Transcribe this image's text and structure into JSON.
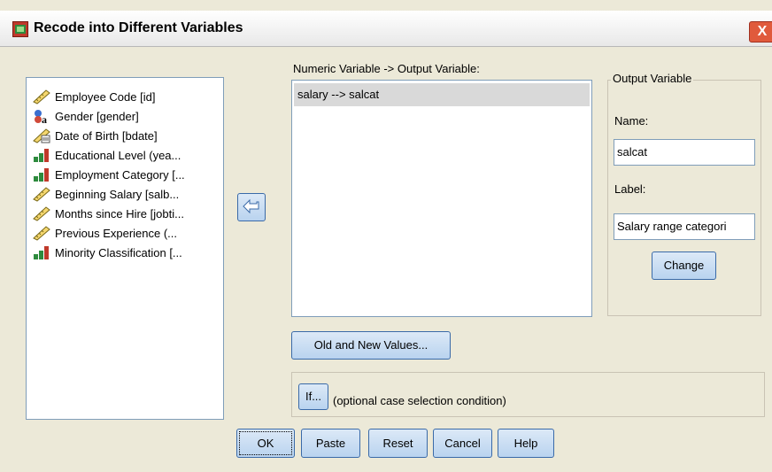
{
  "window": {
    "title": "Recode into Different Variables",
    "close_label": "X"
  },
  "source_list": {
    "items": [
      {
        "label": "Employee Code [id]",
        "icon": "scale-ruler-icon"
      },
      {
        "label": "Gender [gender]",
        "icon": "nominal-string-icon"
      },
      {
        "label": "Date of Birth [bdate]",
        "icon": "date-ruler-icon"
      },
      {
        "label": "Educational Level (yea...",
        "icon": "ordinal-bar-icon"
      },
      {
        "label": "Employment Category [...",
        "icon": "ordinal-bar-icon"
      },
      {
        "label": "Beginning Salary [salb...",
        "icon": "scale-ruler-icon"
      },
      {
        "label": "Months since Hire [jobti...",
        "icon": "scale-ruler-icon"
      },
      {
        "label": "Previous Experience (...",
        "icon": "scale-ruler-icon"
      },
      {
        "label": "Minority Classification [...",
        "icon": "ordinal-bar-icon"
      }
    ]
  },
  "mapping": {
    "header": "Numeric Variable -> Output Variable:",
    "rows": [
      "salary --> salcat"
    ]
  },
  "output_variable": {
    "legend": "Output Variable",
    "name_label": "Name:",
    "name_value": "salcat",
    "label_label": "Label:",
    "label_value": "Salary range categori",
    "change_label": "Change"
  },
  "buttons": {
    "old_new_values": "Old and New Values...",
    "if": "If...",
    "if_caption": "(optional case selection condition)",
    "ok": "OK",
    "paste": "Paste",
    "reset": "Reset",
    "cancel": "Cancel",
    "help": "Help"
  }
}
